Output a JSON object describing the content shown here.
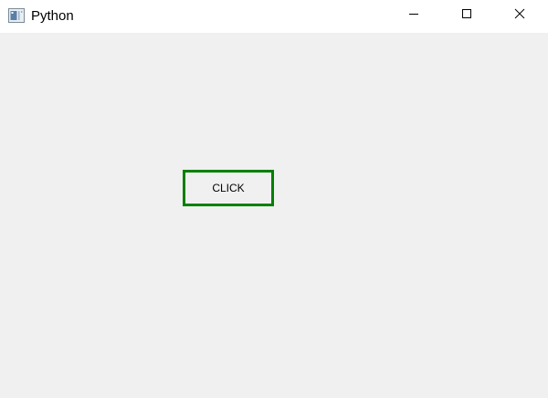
{
  "window": {
    "title": "Python",
    "controls": {
      "minimize_icon": "minimize-icon",
      "maximize_icon": "maximize-icon",
      "close_icon": "close-icon"
    }
  },
  "main": {
    "button_label": "CLICK",
    "button_border_color": "#008000"
  },
  "colors": {
    "titlebar": "#ffffff",
    "background": "#f0f0f0"
  }
}
